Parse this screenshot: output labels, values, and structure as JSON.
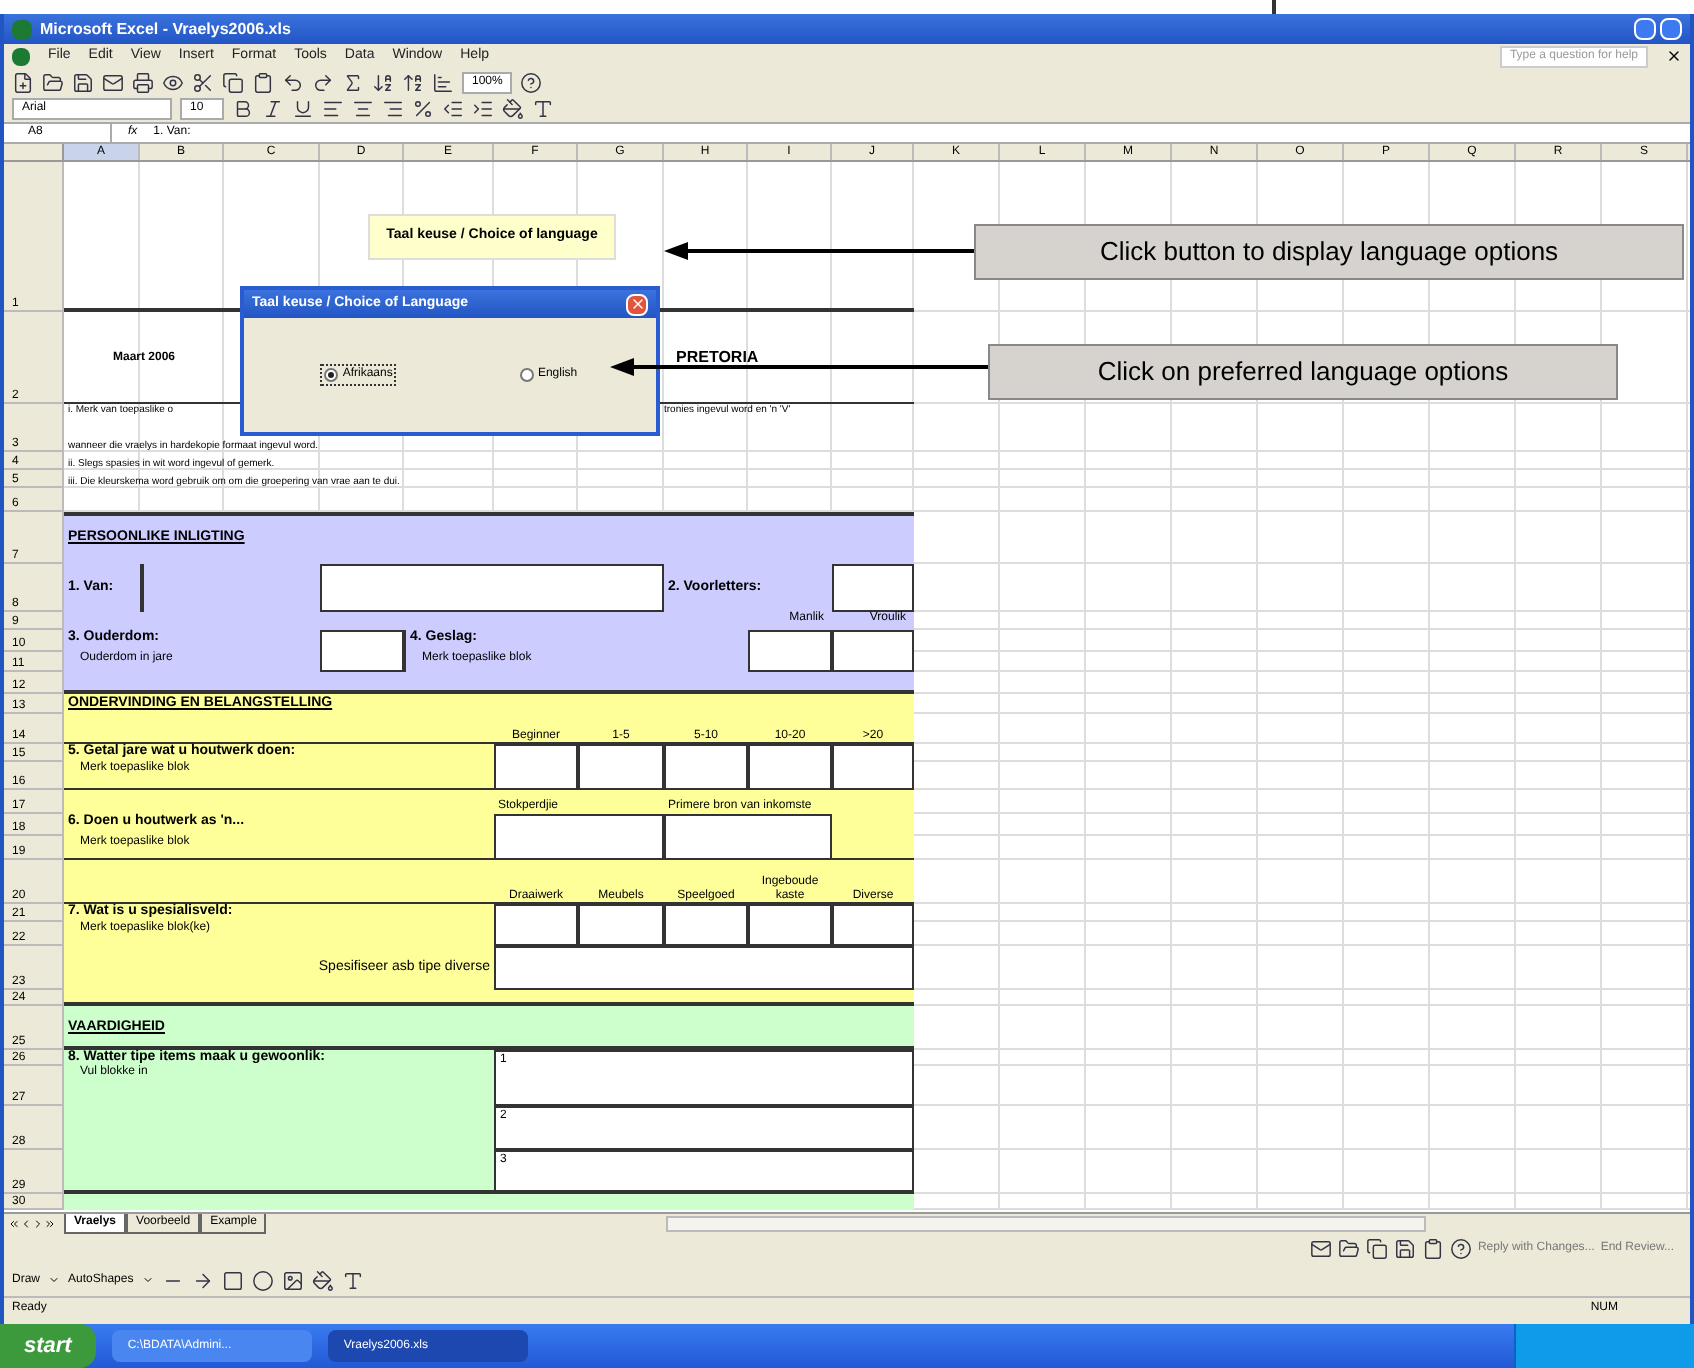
{
  "window": {
    "title": "Microsoft Excel - Vraelys2006.xls"
  },
  "menu": [
    "File",
    "Edit",
    "View",
    "Insert",
    "Format",
    "Tools",
    "Data",
    "Window",
    "Help"
  ],
  "help_box": {
    "placeholder": "Type a question for help"
  },
  "toolbar": {
    "zoom": "100%"
  },
  "format_toolbar": {
    "font": "Arial",
    "size": "10"
  },
  "formula_bar": {
    "name_box": "A8",
    "function_label": "fx",
    "formula": "1. Van:"
  },
  "columns": [
    "A",
    "B",
    "C",
    "D",
    "E",
    "F",
    "G",
    "H",
    "I",
    "J",
    "K",
    "L",
    "M",
    "N",
    "O",
    "P",
    "Q",
    "R",
    "S"
  ],
  "rows": [
    "1",
    "2",
    "3",
    "4",
    "5",
    "6",
    "7",
    "8",
    "9",
    "10",
    "11",
    "12",
    "13",
    "14",
    "15",
    "16",
    "17",
    "18",
    "19",
    "20",
    "21",
    "22",
    "23",
    "24",
    "25",
    "26",
    "27",
    "28",
    "29",
    "30"
  ],
  "form": {
    "language_button": "Taal keuse / Choice of language",
    "date": "Maart 2006",
    "heading_fragment": "PRETORIA",
    "instruction_1_left": "i. Merk van toepaslike o",
    "instruction_1_right": "tronies ingevul word en 'n 'V'",
    "instructions": [
      "wanneer die vraelys in hardekopie formaat ingevul word.",
      "ii. Slegs spasies in wit word ingevul of gemerk.",
      "iii. Die kleurskema word gebruik om om die groepering van vrae aan te dui."
    ],
    "personal": {
      "heading": "PERSOONLIKE INLIGTING",
      "surname": "1. Van:",
      "initials": "2. Voorletters:",
      "male": "Manlik",
      "female": "Vroulik",
      "age": "3. Ouderdom:",
      "age_hint": "Ouderdom in jare",
      "gender": "4. Geslag:",
      "gender_hint": "Merk toepaslike blok"
    },
    "experience": {
      "heading": "ONDERVINDING EN BELANGSTELLING",
      "q5": {
        "label": "5. Getal jare wat u houtwerk doen:",
        "hint": "Merk toepaslike blok",
        "options": [
          "Beginner",
          "1-5",
          "5-10",
          "10-20",
          ">20"
        ]
      },
      "q6": {
        "label": "6. Doen u houtwerk as 'n...",
        "hint": "Merk toepaslike blok",
        "options": [
          "Stokperdjie",
          "Primere bron van inkomste"
        ]
      },
      "q7": {
        "label": "7. Wat is u spesialisveld:",
        "hint": "Merk toepaslike blok(ke)",
        "options": [
          "Draaiwerk",
          "Meubels",
          "Speelgoed",
          "Ingeboude kaste",
          "Diverse"
        ],
        "specify": "Spesifiseer asb tipe diverse"
      }
    },
    "skills": {
      "heading": "VAARDIGHEID",
      "q8": {
        "label": "8. Watter tipe items maak u gewoonlik:",
        "hint": "Vul blokke in",
        "lines": [
          "1",
          "2",
          "3"
        ]
      }
    }
  },
  "dialog": {
    "title": "Taal keuse / Choice of Language",
    "options": [
      {
        "label": "Afrikaans",
        "selected": true
      },
      {
        "label": "English",
        "selected": false
      }
    ]
  },
  "callouts": [
    "Click button to display language options",
    "Click on preferred language options"
  ],
  "sheet_tabs": [
    {
      "label": "Vraelys",
      "selected": true
    },
    {
      "label": "Voorbeeld",
      "selected": false
    },
    {
      "label": "Example",
      "selected": false
    }
  ],
  "review_toolbar": [
    "Reply with Changes...",
    "End Review..."
  ],
  "drawing_toolbar": [
    "Draw",
    "AutoShapes"
  ],
  "status_bar": {
    "left": "Ready",
    "right": "NUM"
  },
  "taskbar": {
    "start": "start",
    "tasks": [
      {
        "label": "C:\\BDATA\\Admini...",
        "selected": false
      },
      {
        "label": "Vraelys2006.xls",
        "selected": true
      }
    ]
  }
}
